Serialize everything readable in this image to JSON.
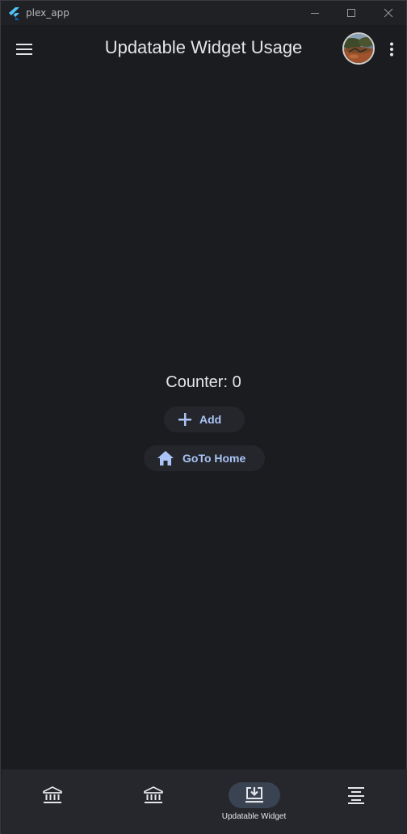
{
  "window": {
    "title": "plex_app"
  },
  "appbar": {
    "title": "Updatable Widget Usage"
  },
  "main": {
    "counter_text": "Counter: 0",
    "add_label": "Add",
    "home_label": "GoTo Home"
  },
  "navbar": {
    "items": [
      {
        "label": "",
        "icon": "bank-icon",
        "active": false
      },
      {
        "label": "",
        "icon": "bank-icon",
        "active": false
      },
      {
        "label": "Updatable Widget",
        "icon": "download-to-screen-icon",
        "active": true
      },
      {
        "label": "",
        "icon": "align-center-icon",
        "active": false
      }
    ]
  },
  "colors": {
    "background": "#1b1c1f",
    "titlebar": "#202124",
    "navbar": "#25272c",
    "nav_active_indicator": "#3a4352",
    "accent": "#a9c4f5",
    "button_bg": "#24262b",
    "text": "#e6e6ea"
  }
}
